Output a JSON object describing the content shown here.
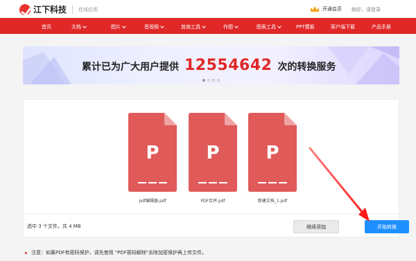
{
  "header": {
    "brand": "江下科技",
    "slogan": "在线应用",
    "vip_label": "开通会员",
    "login_text": "助好，请登录"
  },
  "nav": {
    "items": [
      {
        "label": "首页",
        "has_menu": false
      },
      {
        "label": "文档",
        "has_menu": true
      },
      {
        "label": "图片",
        "has_menu": true
      },
      {
        "label": "音视频",
        "has_menu": true
      },
      {
        "label": "其他工具",
        "has_menu": true
      },
      {
        "label": "作图",
        "has_menu": true
      },
      {
        "label": "图表工具",
        "has_menu": true
      },
      {
        "label": "PPT模板",
        "has_menu": false
      },
      {
        "label": "客户端下载",
        "has_menu": false
      },
      {
        "label": "产品手册",
        "has_menu": false
      }
    ]
  },
  "banner": {
    "prefix": "累计已为广大用户提供",
    "count": "12554642",
    "suffix": "次的转换服务",
    "slides": 4,
    "active_slide": 1
  },
  "files": [
    {
      "name": "pdf编辑器.pdf",
      "icon_letter": "P"
    },
    {
      "name": "PDF合并.pdf",
      "icon_letter": "P"
    },
    {
      "name": "新建文档_1.pdf",
      "icon_letter": "P"
    }
  ],
  "panel": {
    "selected_info": "选中 3 个文件，共 4 MB",
    "add_button": "继续添加",
    "start_button": "开始转换"
  },
  "notice": "注意：如果PDF有密码保护，请先使用 \"PDF密码解除\"去除加密保护再上传文件。",
  "colors": {
    "nav_red": "#e02828",
    "file_red": "#e05a5a",
    "button_blue": "#1e90ff"
  }
}
